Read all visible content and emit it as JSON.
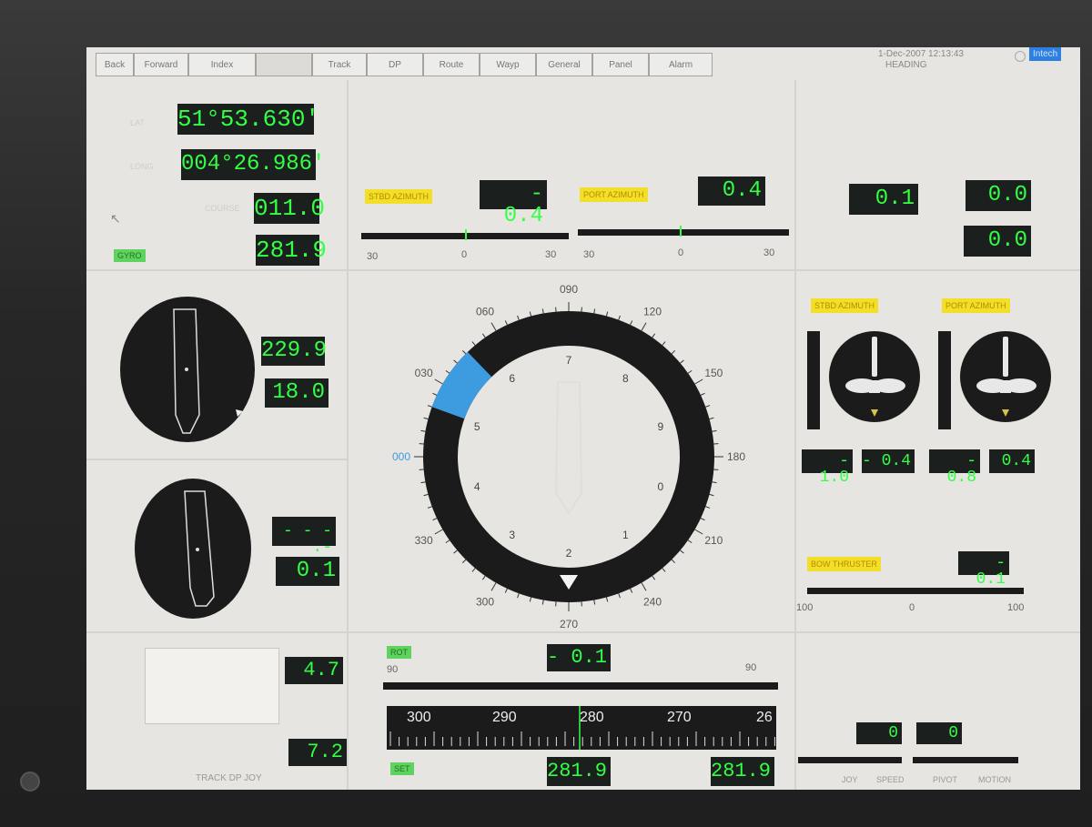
{
  "menu": {
    "items": [
      "Back",
      "Forward",
      "Index",
      "",
      "Track",
      "DP",
      "Route",
      "Wayp",
      "General",
      "Panel",
      "Alarm"
    ],
    "datetime": "1-Dec-2007 12:13:43",
    "page": "HEADING",
    "brand": "Intech"
  },
  "position": {
    "latitude": "51°53.630'",
    "longitude": "004°26.986'",
    "course": "011.0",
    "heading": "281.9",
    "gyro_tag": "GYRO",
    "course_label": "COURSE",
    "lat_label": "LAT",
    "lon_label": "LONG"
  },
  "azimuth_top": {
    "stbd_label": "STBD AZIMUTH",
    "stbd_value": "- 0.4",
    "port_label": "PORT AZIMUTH",
    "port_value": "0.4",
    "scale": [
      "30",
      "0",
      "30"
    ]
  },
  "right_top": {
    "value1": "0.1",
    "value2": "0.0",
    "value3": "0.0"
  },
  "wind": {
    "direction": "229.9",
    "speed": "18.0"
  },
  "current": {
    "direction": "- - - .-",
    "speed": "0.1"
  },
  "compass": {
    "labels": [
      "000",
      "030",
      "060",
      "090",
      "120",
      "150",
      "180",
      "210",
      "240",
      "270",
      "300",
      "330"
    ],
    "inner": [
      "2",
      "1",
      "0",
      "9",
      "8",
      "7",
      "6",
      "5",
      "4",
      "3"
    ]
  },
  "thrusters": {
    "stbd_label": "STBD AZIMUTH",
    "port_label": "PORT AZIMUTH",
    "stbd_a": "- 1.0",
    "stbd_b": "- 0.4",
    "port_a": "- 0.8",
    "port_b": "0.4",
    "bow_label": "BOW THRUSTER",
    "bow_value": "- 0.1",
    "bow_scale": [
      "100",
      "0",
      "100"
    ]
  },
  "bottom_left": {
    "value1": "4.7",
    "value2": "7.2",
    "footer": "TRACK  DP  JOY"
  },
  "rate": {
    "tag": "ROT",
    "value": "- 0.1",
    "scale_left": "90",
    "scale_right": "90"
  },
  "heading_tape": {
    "labels": [
      "300",
      "290",
      "280",
      "270",
      "26"
    ],
    "actual": "281.9",
    "set": "281.9",
    "tag": "SET"
  },
  "joystick": {
    "value1": "0",
    "value2": "0",
    "labels": [
      "JOY",
      "SPEED",
      "PIVOT",
      "MOTION"
    ]
  }
}
